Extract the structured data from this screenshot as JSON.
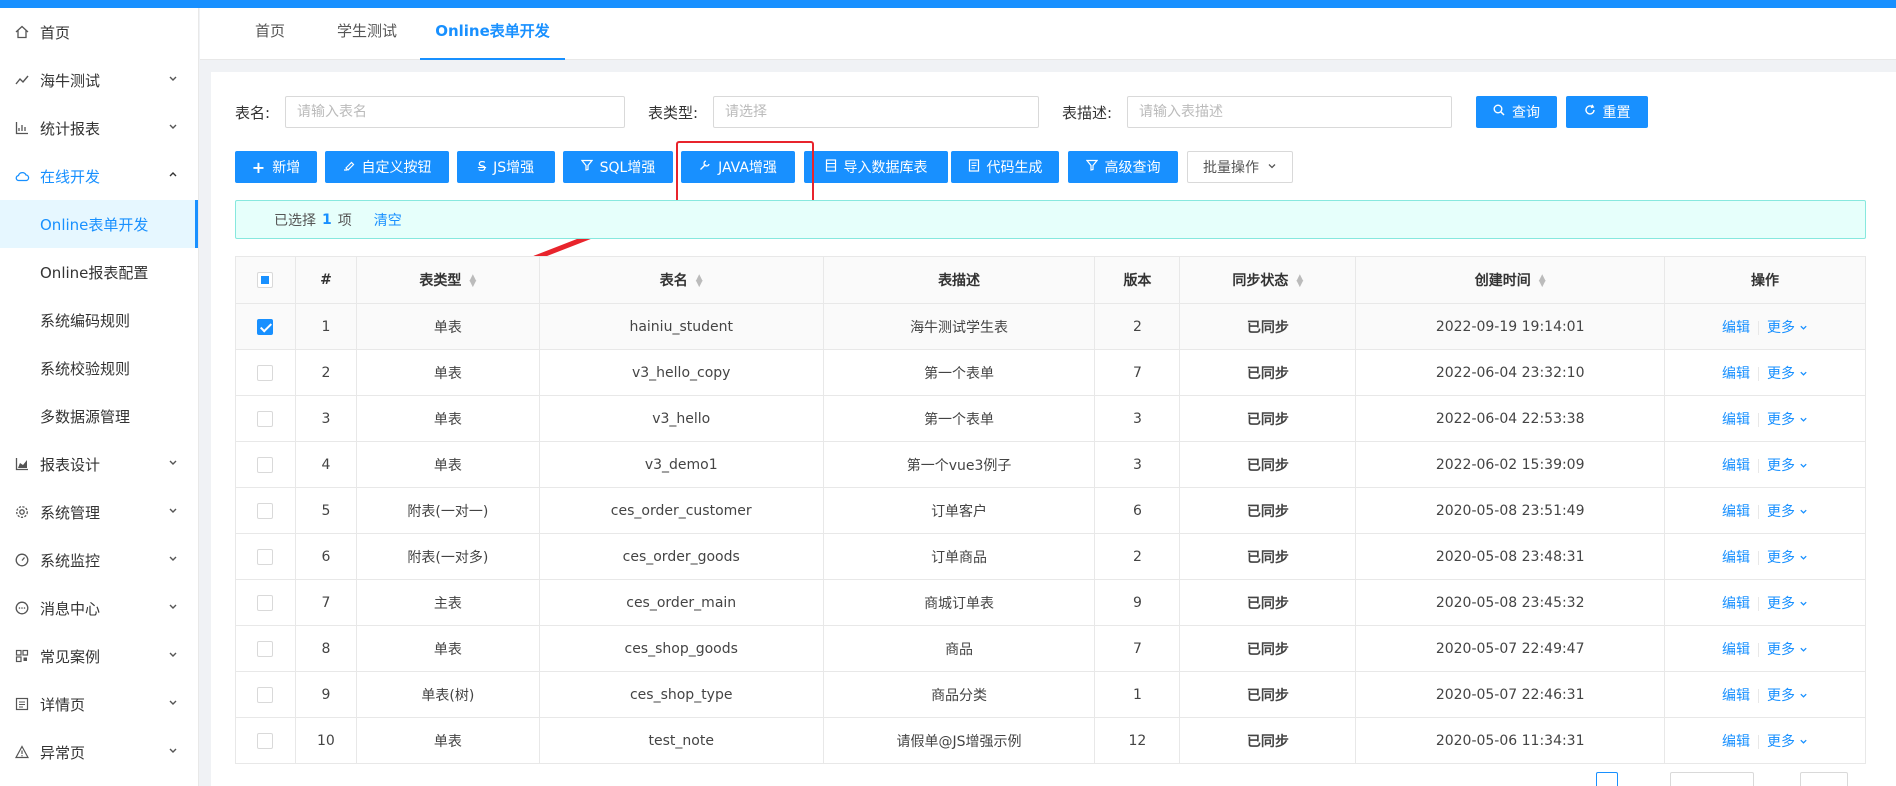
{
  "sidebar": {
    "items": [
      {
        "label": "首页",
        "icon": "home-icon",
        "arrow": ""
      },
      {
        "label": "海牛测试",
        "icon": "line-chart-icon",
        "arrow": "⌄"
      },
      {
        "label": "统计报表",
        "icon": "bar-chart-icon",
        "arrow": "⌄"
      },
      {
        "label": "在线开发",
        "icon": "cloud-icon",
        "arrow": "⌃"
      }
    ],
    "sub_items": [
      {
        "label": "Online表单开发"
      },
      {
        "label": "Online报表配置"
      },
      {
        "label": "系统编码规则"
      },
      {
        "label": "系统校验规则"
      },
      {
        "label": "多数据源管理"
      }
    ],
    "items_after": [
      {
        "label": "报表设计",
        "icon": "area-chart-icon"
      },
      {
        "label": "系统管理",
        "icon": "gear-icon"
      },
      {
        "label": "系统监控",
        "icon": "dashboard-icon"
      },
      {
        "label": "消息中心",
        "icon": "message-icon"
      },
      {
        "label": "常见案例",
        "icon": "qrcode-icon"
      },
      {
        "label": "详情页",
        "icon": "profile-icon"
      },
      {
        "label": "异常页",
        "icon": "warning-icon"
      }
    ]
  },
  "tabs": [
    {
      "label": "首页"
    },
    {
      "label": "学生测试"
    },
    {
      "label": "Online表单开发"
    }
  ],
  "filters": {
    "name_label": "表名:",
    "name_placeholder": "请输入表名",
    "type_label": "表类型:",
    "type_placeholder": "请选择",
    "desc_label": "表描述:",
    "desc_placeholder": "请输入表描述",
    "search_label": "查询",
    "reset_label": "重置"
  },
  "toolbar": {
    "add": "新增",
    "custom": "自定义按钮",
    "js": "JS增强",
    "sql": "SQL增强",
    "java": "JAVA增强",
    "import": "导入数据库表",
    "codegen": "代码生成",
    "advanced": "高级查询",
    "batch": "批量操作"
  },
  "alert": {
    "prefix": "已选择",
    "count": "1",
    "suffix": "项",
    "clear": "清空"
  },
  "table": {
    "headers": [
      "#",
      "表类型",
      "表名",
      "表描述",
      "版本",
      "同步状态",
      "创建时间",
      "操作"
    ],
    "edit_label": "编辑",
    "more_label": "更多",
    "rows": [
      {
        "no": "1",
        "type": "单表",
        "name": "hainiu_student",
        "desc": "海牛测试学生表",
        "version": "2",
        "sync": "已同步",
        "created": "2022-09-19 19:14:01"
      },
      {
        "no": "2",
        "type": "单表",
        "name": "v3_hello_copy",
        "desc": "第一个表单",
        "version": "7",
        "sync": "已同步",
        "created": "2022-06-04 23:32:10"
      },
      {
        "no": "3",
        "type": "单表",
        "name": "v3_hello",
        "desc": "第一个表单",
        "version": "3",
        "sync": "已同步",
        "created": "2022-06-04 22:53:38"
      },
      {
        "no": "4",
        "type": "单表",
        "name": "v3_demo1",
        "desc": "第一个vue3例子",
        "version": "3",
        "sync": "已同步",
        "created": "2022-06-02 15:39:09"
      },
      {
        "no": "5",
        "type": "附表(一对一)",
        "name": "ces_order_customer",
        "desc": "订单客户",
        "version": "6",
        "sync": "已同步",
        "created": "2020-05-08 23:51:49"
      },
      {
        "no": "6",
        "type": "附表(一对多)",
        "name": "ces_order_goods",
        "desc": "订单商品",
        "version": "2",
        "sync": "已同步",
        "created": "2020-05-08 23:48:31"
      },
      {
        "no": "7",
        "type": "主表",
        "name": "ces_order_main",
        "desc": "商城订单表",
        "version": "9",
        "sync": "已同步",
        "created": "2020-05-08 23:45:32"
      },
      {
        "no": "8",
        "type": "单表",
        "name": "ces_shop_goods",
        "desc": "商品",
        "version": "7",
        "sync": "已同步",
        "created": "2020-05-07 22:49:47"
      },
      {
        "no": "9",
        "type": "单表(树)",
        "name": "ces_shop_type",
        "desc": "商品分类",
        "version": "1",
        "sync": "已同步",
        "created": "2020-05-07 22:46:31"
      },
      {
        "no": "10",
        "type": "单表",
        "name": "test_note",
        "desc": "请假单@JS增强示例",
        "version": "12",
        "sync": "已同步",
        "created": "2020-05-06 11:34:31"
      }
    ]
  },
  "colors": {
    "primary": "#1890ff",
    "success": "#52c41a",
    "annotation": "#e8242c"
  }
}
